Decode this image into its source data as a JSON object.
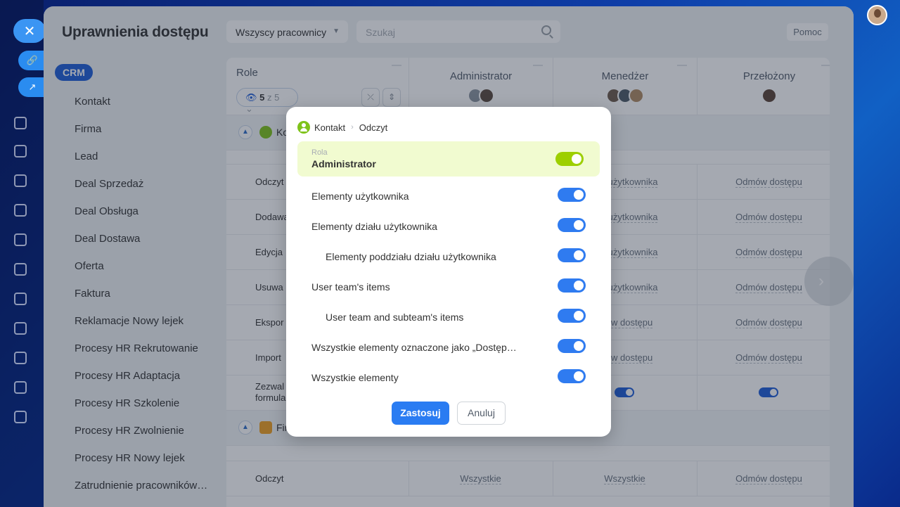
{
  "header": {
    "title": "Uprawnienia dostępu",
    "filter_label": "Wszyscy pracownicy",
    "search_placeholder": "Szukaj",
    "help_label": "Pomoc"
  },
  "sidebar": {
    "tag": "CRM",
    "items": [
      "Kontakt",
      "Firma",
      "Lead",
      "Deal Sprzedaż",
      "Deal Obsługa",
      "Deal Dostawa",
      "Oferta",
      "Faktura",
      "Reklamacje Nowy lejek",
      "Procesy HR Rekrutowanie",
      "Procesy HR Adaptacja",
      "Procesy HR Szkolenie",
      "Procesy HR Zwolnienie",
      "Procesy HR Nowy lejek",
      "Zatrudnienie pracowników…"
    ]
  },
  "table": {
    "role_header": "Role",
    "visible_count": "5",
    "visible_of": "z 5",
    "columns": [
      "Administrator",
      "Menedżer",
      "Przełożony"
    ],
    "sections": [
      {
        "label": "Kontakt",
        "short": "Ko"
      },
      {
        "label": "Firma",
        "short": "Fir"
      }
    ],
    "rows": [
      {
        "label": "Odczyt",
        "menedzer": "…y użytkownika",
        "przelozony": "Odmów dostępu"
      },
      {
        "label": "Dodawa",
        "menedzer": "…y użytkownika",
        "przelozony": "Odmów dostępu"
      },
      {
        "label": "Edycja",
        "menedzer": "…y użytkownika",
        "przelozony": "Odmów dostępu"
      },
      {
        "label": "Usuwa",
        "menedzer": "…y użytkownika",
        "przelozony": "Odmów dostępu"
      },
      {
        "label": "Ekspor",
        "menedzer": "…ów dostępu",
        "przelozony": "Odmów dostępu"
      },
      {
        "label": "Import",
        "menedzer": "…ów dostępu",
        "przelozony": "Odmów dostępu"
      },
      {
        "label_line1": "Zezwal",
        "label_line2": "formula"
      }
    ],
    "firma_row": {
      "label": "Odczyt",
      "admin": "Wszystkie",
      "menedzer": "Wszystkie",
      "przelozony": "Odmów dostępu"
    }
  },
  "modal": {
    "breadcrumb_entity": "Kontakt",
    "breadcrumb_action": "Odczyt",
    "role_caption": "Rola",
    "role_value": "Administrator",
    "options": [
      {
        "label": "Elementy użytkownika",
        "indent": false,
        "on": true
      },
      {
        "label": "Elementy działu użytkownika",
        "indent": false,
        "on": true
      },
      {
        "label": "Elementy poddziału działu użytkownika",
        "indent": true,
        "on": true
      },
      {
        "label": "User team's items",
        "indent": false,
        "on": true
      },
      {
        "label": "User team and subteam's items",
        "indent": true,
        "on": true
      },
      {
        "label": "Wszystkie elementy oznaczone jako „Dostęp…",
        "indent": false,
        "on": true
      },
      {
        "label": "Wszystkie elementy",
        "indent": false,
        "on": true
      }
    ],
    "apply_label": "Zastosuj",
    "cancel_label": "Anuluj"
  },
  "colors": {
    "accent": "#2a7cf2",
    "role_highlight": "#f1fbd0",
    "role_toggle": "#9dcf00",
    "contact_icon": "#7fc31a",
    "company_icon": "#f0a020"
  }
}
